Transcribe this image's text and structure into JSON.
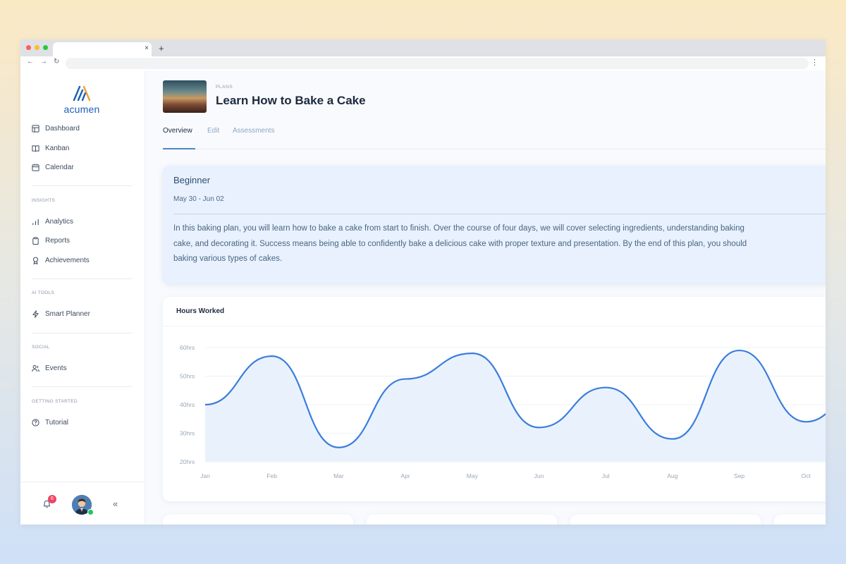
{
  "window": {
    "tab_close": "×",
    "new_tab": "+"
  },
  "toolbar": {
    "back": "←",
    "forward": "→",
    "reload": "↻",
    "menu": "⋮"
  },
  "sidebar": {
    "logo_text": "acumen",
    "items": [
      {
        "label": "Dashboard",
        "icon": "layout-icon"
      },
      {
        "label": "Kanban",
        "icon": "book-icon"
      },
      {
        "label": "Calendar",
        "icon": "calendar-icon"
      }
    ],
    "sections": [
      {
        "title": "INSIGHTS",
        "items": [
          {
            "label": "Analytics",
            "icon": "bar-chart-icon"
          },
          {
            "label": "Reports",
            "icon": "clipboard-icon"
          },
          {
            "label": "Achievements",
            "icon": "award-icon"
          }
        ]
      },
      {
        "title": "AI TOOLS",
        "items": [
          {
            "label": "Smart Planner",
            "icon": "lightning-icon"
          }
        ]
      },
      {
        "title": "SOCIAL",
        "items": [
          {
            "label": "Events",
            "icon": "users-icon"
          }
        ]
      },
      {
        "title": "GETTING STARTED",
        "items": [
          {
            "label": "Tutorial",
            "icon": "help-circle-icon"
          }
        ]
      }
    ],
    "footer": {
      "notification_count": "6",
      "collapse": "«"
    }
  },
  "header": {
    "breadcrumb": "PLANS",
    "title": "Learn How to Bake a Cake",
    "tabs": [
      "Overview",
      "Edit",
      "Assessments"
    ],
    "active_tab": "Overview"
  },
  "plan": {
    "level": "Beginner",
    "dates": "May 30 - Jun 02",
    "description": "In this baking plan, you will learn how to bake a cake from start to finish. Over the course of four days, we will cover selecting ingredients, understanding baking\ncake, and decorating it. Success means being able to confidently bake a delicious cake with proper texture and presentation. By the end of this plan, you should\nbaking various types of cakes."
  },
  "chart_data": {
    "type": "area",
    "title": "Hours Worked",
    "categories": [
      "Jan",
      "Feb",
      "Mar",
      "Apr",
      "May",
      "Jun",
      "Jul",
      "Aug",
      "Sep",
      "Oct"
    ],
    "values": [
      40,
      57,
      25,
      49,
      58,
      32,
      46,
      28,
      59,
      34
    ],
    "y_ticks": [
      "20hrs",
      "30hrs",
      "40hrs",
      "50hrs",
      "60hrs"
    ],
    "ylim": [
      20,
      60
    ],
    "grid": true,
    "color": "#3b7ddd"
  },
  "colors": {
    "accent": "#1e5fb4",
    "chart_line": "#3b7ddd",
    "chart_fill": "#e9f2fc",
    "badge": "#ef4565"
  }
}
